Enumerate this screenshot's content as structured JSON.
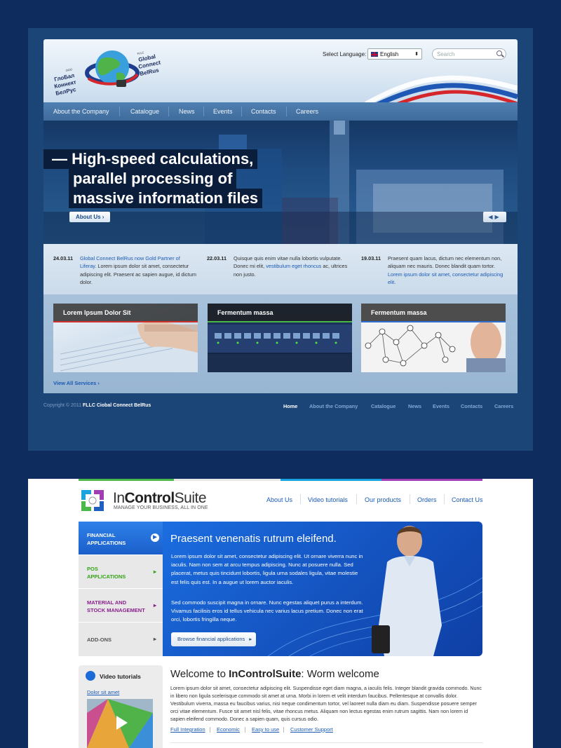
{
  "site1": {
    "logo": {
      "left_text": [
        "ГлоБал",
        "Коннект",
        "БелРус"
      ],
      "right_text": [
        "Global",
        "Connect",
        "BelRus"
      ],
      "tiny_left": "ООО",
      "tiny_right": "FLLC"
    },
    "language": {
      "label": "Select Language:",
      "selected": "English"
    },
    "search": {
      "placeholder": "Search"
    },
    "nav": [
      "About the Company",
      "Catalogue",
      "News",
      "Events",
      "Contacts",
      "Careers"
    ],
    "hero": {
      "lines": [
        "High-speed calculations,",
        "parallel processing of",
        "massive information files"
      ],
      "button": "About Us"
    },
    "news": [
      {
        "date": "24.03.11",
        "link": "Global Connect BelRus now Gold Partner of Liferay.",
        "text": " Lorem ipsum dolor sit amet, consectetur adipiscing elit. Praesent ac sapien augue, id dictum dolor."
      },
      {
        "date": "22.03.11",
        "text1": "Quisque quis enim vitae nulla lobortis vulputate. Donec mi elit, ",
        "link": "vestibulum eget rhoncus",
        "text2": " ac, ultrices non justo."
      },
      {
        "date": "19.03.11",
        "text1": "Praesent quam lacus, dictum nec elementum non, aliquam nec mauris. Donec blandit quam tortor. ",
        "link": "Lorem ipsum dolor sit amet, consectetur adipiscing elit."
      }
    ],
    "cards": [
      "Lorem Ipsum Dolor Sit",
      "Fermentum massa",
      "Fermentum massa"
    ],
    "view_all": "View All Services",
    "footer": {
      "copyright_prefix": "Copyright © 2011",
      "copyright_company": "FLLC Ciobal Connect BelRus",
      "links": [
        "Home",
        "About the Company",
        "Catalogue",
        "News",
        "Events",
        "Contacts",
        "Careers"
      ]
    }
  },
  "site2": {
    "brand": {
      "prefix": "In",
      "bold": "Control",
      "suffix": "Suite",
      "tagline": "MANAGE YOUR BUSINESS, ALL IN ONE"
    },
    "nav": [
      "About Us",
      "Video tutorials",
      "Our products",
      "Orders",
      "Contact Us"
    ],
    "side_menu": [
      {
        "line1": "FINANCIAL",
        "line2": "APPLICATIONS",
        "color": "#ffffff"
      },
      {
        "line1": "POS",
        "line2": "APPLICATIONS",
        "color": "#33a314"
      },
      {
        "line1": "MATERIAL AND",
        "line2": "STOCK MANAGEMENT",
        "color": "#8a1f8c"
      },
      {
        "line1": "ADD-ONS",
        "line2": "",
        "color": "#555555"
      }
    ],
    "banner": {
      "title": "Praesent venenatis rutrum eleifend.",
      "p1": "Lorem ipsum dolor sit amet, consectetur adipiscing elit. Ut ornare viverra nunc in iaculis. Nam non sem at arcu tempus adipiscing. Nunc at posuere nulla. Sed placerat, metus quis tincidunt lobortis, ligula urna sodales ligula, vitae molestie est felis quis est. In a augue ut lorem auctor iaculis.",
      "p2": "Sed commodo suscipit magna in ornare. Nunc egestas aliquet purus a interdum. Vivamus facilisis eros id tellus vehicula nec varius lacus pretium. Donec non erat orci, lobortis fringilla neque.",
      "button": "Browse financial applications"
    },
    "video": {
      "title": "Video tutorials",
      "link": "Dolor sit amet"
    },
    "welcome": {
      "prefix": "Welcome to ",
      "bold": "InControlSuite",
      "suffix": ": Worm welcome",
      "text": "Lorem ipsum dolor sit amet, consectetur adipiscing elit. Suspendisse eget diam magna, a iaculis felis. Integer blandit gravida commodo. Nunc in libero non ligula scelerisque commodo sit amet at urna. Morbi in lorem et velit interdum faucibus. Pellentesque at convallis dolor. Vestibulum viverra, massa eu faucibus varius, nisi neque condimentum tortor, vel laoreet nulla diam eu diam. Suspendisse posuere semper orci vitae elementum. Fusce sit amet nisl felis, vitae rhoncus metus. Aliquam non lectus egestas enim rutrum sagittis. Nam non lorem id sapien eleifend commodo. Donec a sapien quam, quis cursus odio.",
      "links": [
        "Full Integration",
        "Economic",
        "Easy to use",
        "Customer Support"
      ]
    }
  }
}
